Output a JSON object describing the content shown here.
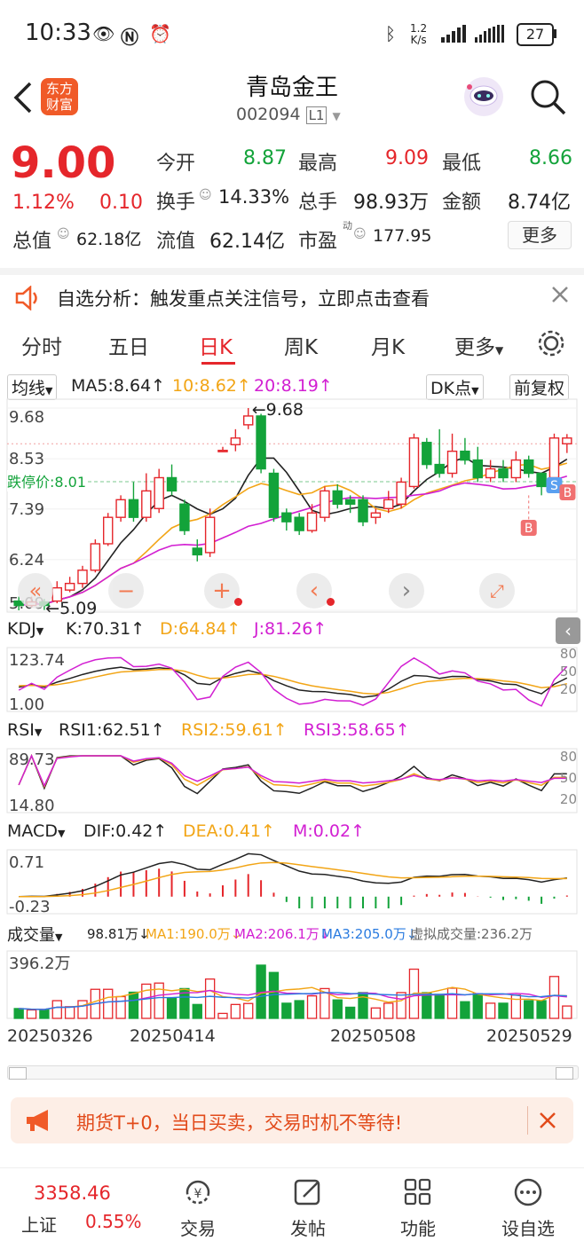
{
  "status": {
    "time": "10:33",
    "net_speed_top": "1.2",
    "net_speed_unit": "K/s",
    "battery": "27"
  },
  "header": {
    "title": "青岛金王",
    "code": "002094",
    "code_tag": "L1",
    "logo_line1": "东方",
    "logo_line2": "财富"
  },
  "quote": {
    "price": "9.00",
    "change_pct": "1.12%",
    "change": "0.10",
    "open_label": "今开",
    "open": "8.87",
    "high_label": "最高",
    "high": "9.09",
    "low_label": "最低",
    "low": "8.66",
    "turnover_label": "换手",
    "turnover": "14.33%",
    "volume_label": "总手",
    "volume": "98.93万",
    "amount_label": "金额",
    "amount": "8.74亿",
    "mktcap_label": "总值",
    "mktcap": "62.18亿",
    "float_label": "流值",
    "float": "62.14亿",
    "pe_label": "市盈",
    "pe_sup": "动",
    "pe": "177.95",
    "more": "更多"
  },
  "notice": {
    "text": "自选分析：触发重点关注信号，立即点击查看"
  },
  "tabs": [
    {
      "label": "分时"
    },
    {
      "label": "五日"
    },
    {
      "label": "日K"
    },
    {
      "label": "周K"
    },
    {
      "label": "月K"
    },
    {
      "label": "更多"
    }
  ],
  "chart_data": {
    "type": "candlestick",
    "ma_label": "均线",
    "ma5": "MA5:8.64↑",
    "ma10": "10:8.62↑",
    "ma20": "20:8.19↑",
    "dk_btn": "DK点",
    "fuquan_btn": "前复权",
    "y_ticks": [
      "9.68",
      "8.53",
      "7.39",
      "6.24",
      "5.09"
    ],
    "limit_down_label": "跌停价:8.01",
    "max_annot": "9.68",
    "min_annot": "5.09",
    "b_marker": "B",
    "s_marker": "S",
    "candles": [
      {
        "o": 5.3,
        "c": 5.2,
        "h": 5.4,
        "l": 5.09
      },
      {
        "o": 5.2,
        "c": 5.28,
        "h": 5.4,
        "l": 5.15
      },
      {
        "o": 5.28,
        "c": 5.2,
        "h": 5.35,
        "l": 5.1
      },
      {
        "o": 5.3,
        "c": 5.6,
        "h": 5.75,
        "l": 5.25
      },
      {
        "o": 5.55,
        "c": 5.7,
        "h": 5.85,
        "l": 5.5
      },
      {
        "o": 5.7,
        "c": 6.0,
        "h": 6.1,
        "l": 5.6
      },
      {
        "o": 6.0,
        "c": 6.6,
        "h": 6.7,
        "l": 5.95
      },
      {
        "o": 6.6,
        "c": 7.2,
        "h": 7.3,
        "l": 6.55
      },
      {
        "o": 7.2,
        "c": 7.6,
        "h": 7.7,
        "l": 7.1
      },
      {
        "o": 7.6,
        "c": 7.2,
        "h": 8.0,
        "l": 7.1
      },
      {
        "o": 7.2,
        "c": 7.8,
        "h": 8.2,
        "l": 7.1
      },
      {
        "o": 7.4,
        "c": 8.1,
        "h": 8.3,
        "l": 7.3
      },
      {
        "o": 8.1,
        "c": 7.8,
        "h": 8.4,
        "l": 7.7
      },
      {
        "o": 7.5,
        "c": 6.9,
        "h": 7.6,
        "l": 6.8
      },
      {
        "o": 6.5,
        "c": 6.35,
        "h": 6.7,
        "l": 6.2
      },
      {
        "o": 6.4,
        "c": 7.2,
        "h": 7.4,
        "l": 6.3
      },
      {
        "o": 8.7,
        "c": 8.72,
        "h": 8.8,
        "l": 8.68
      },
      {
        "o": 8.85,
        "c": 9.0,
        "h": 9.2,
        "l": 8.7
      },
      {
        "o": 9.3,
        "c": 9.5,
        "h": 9.68,
        "l": 9.2
      },
      {
        "o": 9.5,
        "c": 8.3,
        "h": 9.55,
        "l": 8.2
      },
      {
        "o": 8.2,
        "c": 7.2,
        "h": 8.3,
        "l": 7.1
      },
      {
        "o": 7.3,
        "c": 7.1,
        "h": 7.4,
        "l": 6.9
      },
      {
        "o": 7.2,
        "c": 6.9,
        "h": 7.3,
        "l": 6.8
      },
      {
        "o": 6.9,
        "c": 7.3,
        "h": 7.5,
        "l": 6.85
      },
      {
        "o": 7.2,
        "c": 7.8,
        "h": 7.9,
        "l": 7.1
      },
      {
        "o": 7.8,
        "c": 7.5,
        "h": 7.95,
        "l": 7.4
      },
      {
        "o": 7.6,
        "c": 7.5,
        "h": 7.7,
        "l": 7.3
      },
      {
        "o": 7.6,
        "c": 7.1,
        "h": 7.7,
        "l": 7.0
      },
      {
        "o": 7.2,
        "c": 7.3,
        "h": 7.4,
        "l": 7.05
      },
      {
        "o": 7.4,
        "c": 7.6,
        "h": 7.8,
        "l": 7.3
      },
      {
        "o": 7.5,
        "c": 8.0,
        "h": 8.1,
        "l": 7.4
      },
      {
        "o": 7.9,
        "c": 9.0,
        "h": 9.1,
        "l": 7.85
      },
      {
        "o": 8.9,
        "c": 8.4,
        "h": 9.0,
        "l": 8.3
      },
      {
        "o": 8.4,
        "c": 8.2,
        "h": 9.2,
        "l": 8.1
      },
      {
        "o": 8.2,
        "c": 8.7,
        "h": 9.1,
        "l": 8.1
      },
      {
        "o": 8.7,
        "c": 8.5,
        "h": 9.0,
        "l": 8.4
      },
      {
        "o": 8.5,
        "c": 8.1,
        "h": 8.8,
        "l": 8.0
      },
      {
        "o": 8.1,
        "c": 8.3,
        "h": 8.5,
        "l": 8.0
      },
      {
        "o": 8.3,
        "c": 8.1,
        "h": 8.5,
        "l": 8.0
      },
      {
        "o": 8.1,
        "c": 8.5,
        "h": 8.7,
        "l": 8.0
      },
      {
        "o": 8.5,
        "c": 8.2,
        "h": 8.6,
        "l": 8.1
      },
      {
        "o": 8.2,
        "c": 7.9,
        "h": 8.2,
        "l": 7.7
      },
      {
        "o": 8.1,
        "c": 9.0,
        "h": 9.1,
        "l": 8.0
      },
      {
        "o": 8.87,
        "c": 9.0,
        "h": 9.09,
        "l": 8.66
      }
    ],
    "kdj": {
      "label": "KDJ",
      "k": "K:70.31↑",
      "d": "D:64.84↑",
      "j": "J:81.26↑",
      "y_top": "123.74",
      "y_bottom": "1.00",
      "levels": [
        "80",
        "50",
        "20"
      ]
    },
    "rsi": {
      "label": "RSI",
      "r1": "RSI1:62.51↑",
      "r2": "RSI2:59.61↑",
      "r3": "RSI3:58.65↑",
      "y_top": "89.73",
      "y_bottom": "14.80",
      "levels": [
        "80",
        "50",
        "20"
      ]
    },
    "macd": {
      "label": "MACD",
      "dif": "DIF:0.42↑",
      "dea": "DEA:0.41↑",
      "m": "M:0.02↑",
      "y_top": "0.71",
      "y_bottom": "-0.23"
    },
    "volume": {
      "label": "成交量",
      "value": "98.81万↓",
      "ma1": "MA1:190.0万↓",
      "ma2": "MA2:206.1万↓",
      "ma3": "MA3:205.0万↓",
      "virtual": "虚拟成交量:236.2万",
      "y_top": "396.2万"
    },
    "dates": [
      "20250326",
      "20250414",
      "20250508",
      "20250529"
    ]
  },
  "promo": {
    "text": "期货T+0，当日买卖，交易时机不等待!"
  },
  "bottom_nav": {
    "index_value": "3358.46",
    "index_name": "上证",
    "index_change": "0.55%",
    "items": [
      {
        "label": "交易"
      },
      {
        "label": "发帖"
      },
      {
        "label": "功能"
      },
      {
        "label": "设自选"
      }
    ]
  },
  "colors": {
    "up": "#e5262b",
    "down": "#13a33a",
    "ma5": "#222222",
    "ma10": "#f2a516",
    "ma20": "#d21fd2"
  }
}
